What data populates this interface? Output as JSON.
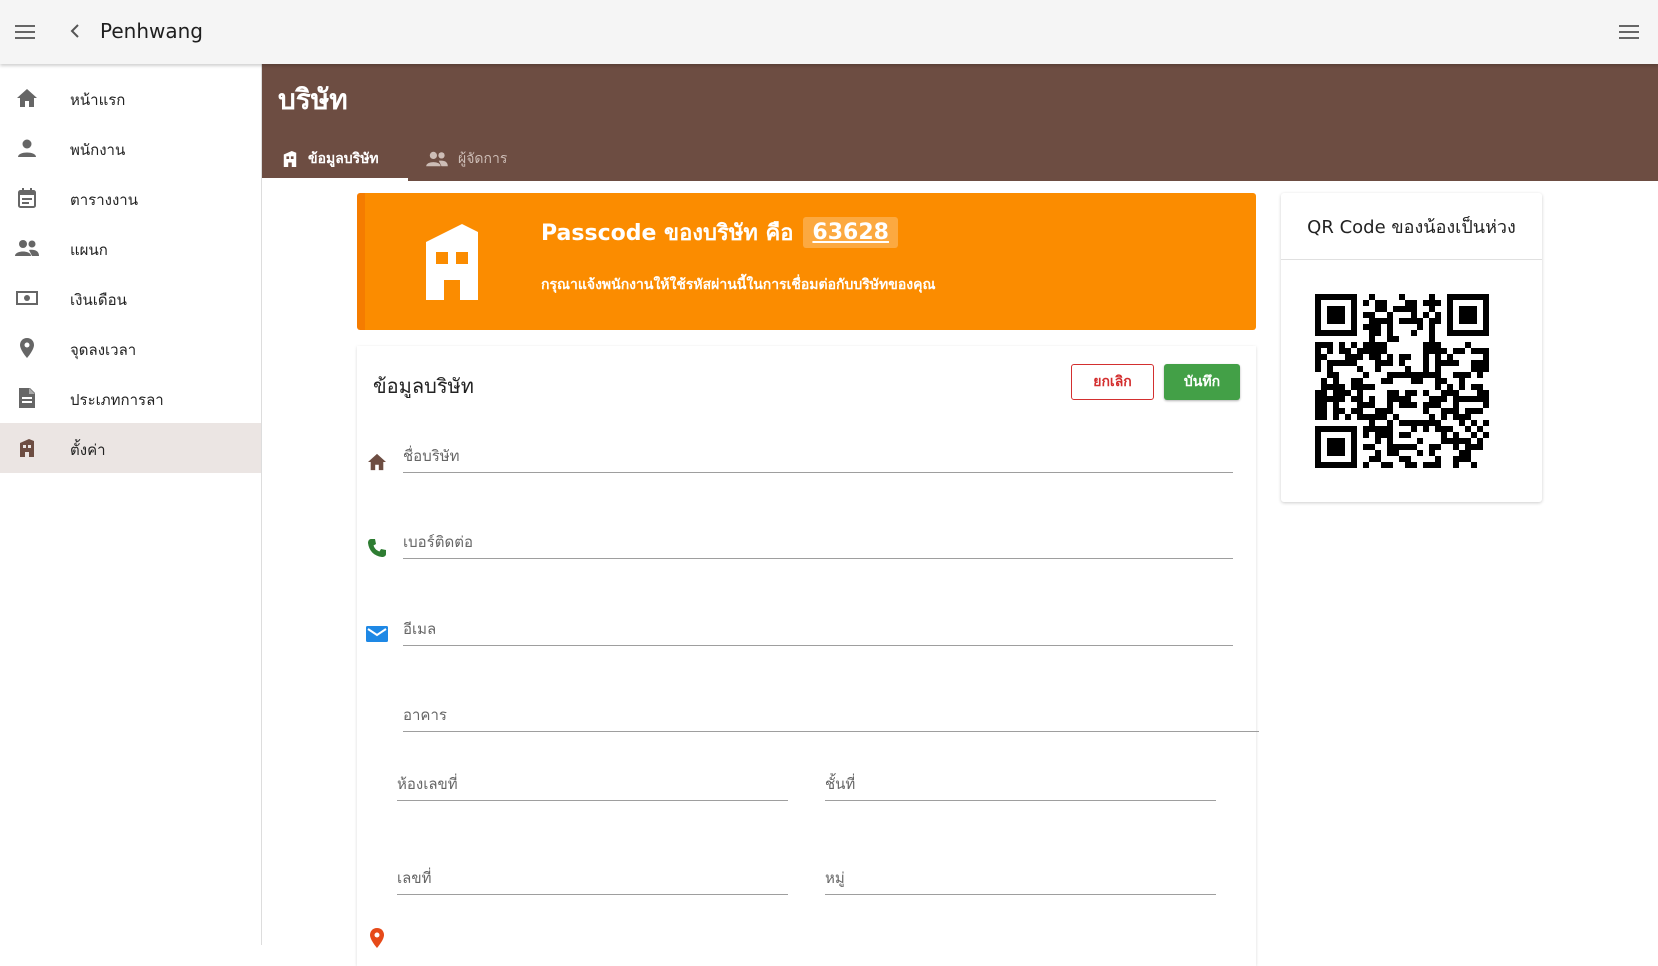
{
  "app": {
    "title": "Penhwang"
  },
  "topbar": {
    "menu_icon": "menu-icon",
    "back_icon": "chevron-left-icon",
    "right_menu_icon": "menu-icon"
  },
  "sidebar": {
    "items": [
      {
        "label": "หน้าแรก",
        "icon": "home-icon"
      },
      {
        "label": "พนักงาน",
        "icon": "person-icon"
      },
      {
        "label": "ตารางงาน",
        "icon": "calendar-icon"
      },
      {
        "label": "แผนก",
        "icon": "people-icon"
      },
      {
        "label": "เงินเดือน",
        "icon": "money-icon"
      },
      {
        "label": "จุดลงเวลา",
        "icon": "location-pin-icon"
      },
      {
        "label": "ประเภทการลา",
        "icon": "document-icon"
      },
      {
        "label": "ตั้งค่า",
        "icon": "building-icon",
        "active": true
      }
    ]
  },
  "header": {
    "title": "บริษัท",
    "tabs": [
      {
        "label": "ข้อมูลบริษัท",
        "icon": "building-icon",
        "active": true
      },
      {
        "label": "ผู้จัดการ",
        "icon": "people-icon",
        "active": false
      }
    ]
  },
  "banner": {
    "title_prefix": "Passcode ของบริษัท คือ",
    "passcode": "63628",
    "subtitle": "กรุณาแจ้งพนักงานให้ใช้รหัสผ่านนี้ในการเชื่อมต่อกับบริษัทของคุณ"
  },
  "form": {
    "title": "ข้อมูลบริษัท",
    "cancel_label": "ยกเลิก",
    "save_label": "บันทึก",
    "fields": {
      "company_name": "ชื่อบริษัท",
      "phone": "เบอร์ติดต่อ",
      "email": "อีเมล",
      "building": "อาคาร",
      "room_no": "ห้องเลขที่",
      "floor": "ชั้นที่",
      "house_no": "เลขที่",
      "village_no": "หมู่"
    }
  },
  "qr": {
    "title": "QR Code ของน้องเป็นห่วง"
  },
  "colors": {
    "header_brown": "#6d4d42",
    "banner_orange": "#fb8c00",
    "save_green": "#43a047",
    "cancel_red": "#d32f2f",
    "phone_green": "#2e7d32",
    "mail_blue": "#1e88e5",
    "pin_red": "#e64a19"
  }
}
